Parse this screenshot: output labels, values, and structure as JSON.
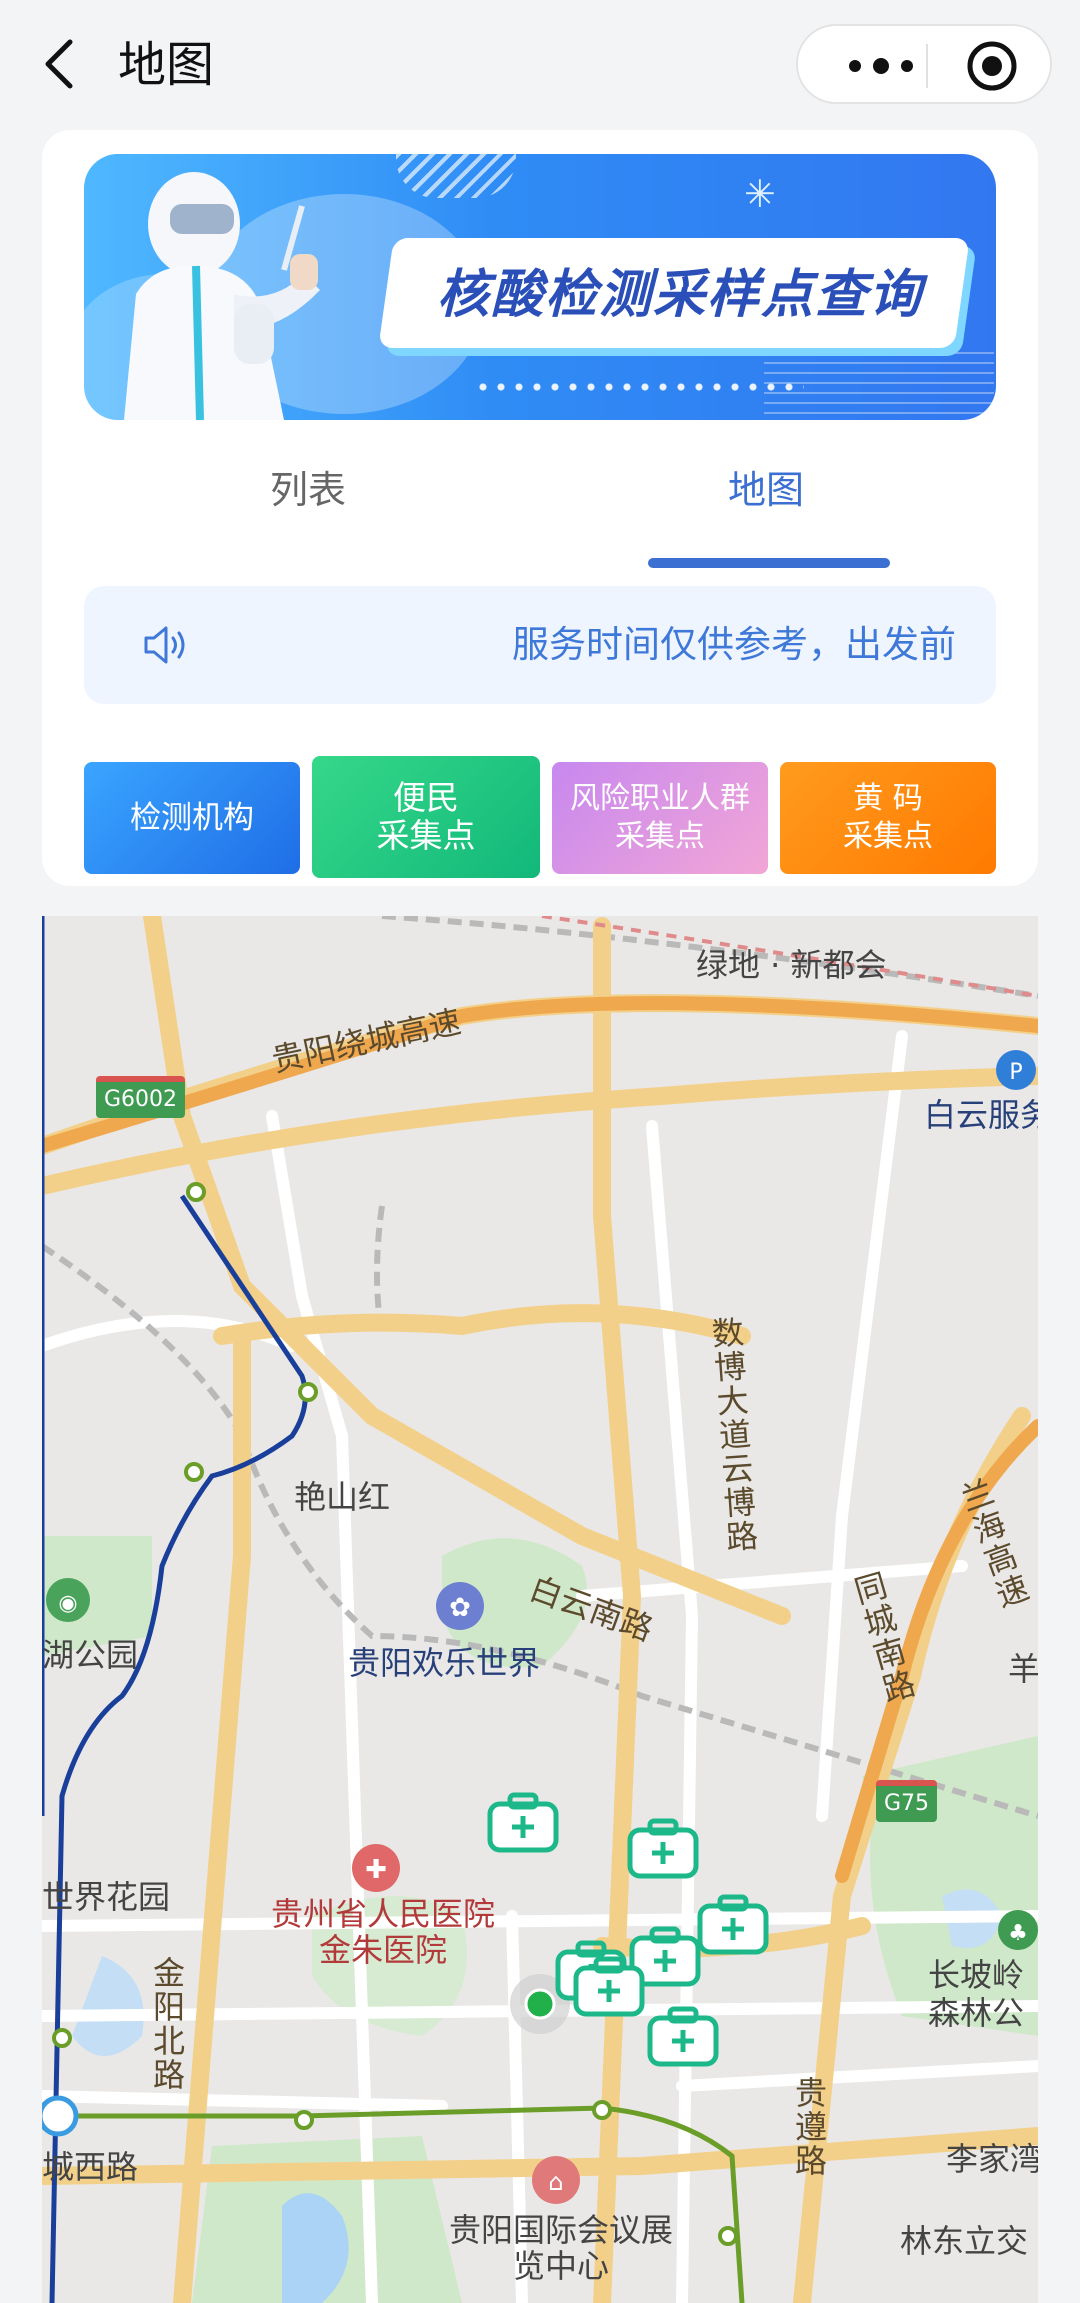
{
  "header": {
    "title": "地图"
  },
  "banner": {
    "title": "核酸检测采样点查询"
  },
  "tabs": [
    {
      "label": "列表"
    },
    {
      "label": "地图"
    }
  ],
  "notice": {
    "text": "服务时间仅供参考，出发前"
  },
  "categories": [
    {
      "label": "检测机构"
    },
    {
      "label": "便民\n采集点"
    },
    {
      "label": "风险职业人群\n采集点"
    },
    {
      "label": "黄 码\n采集点"
    }
  ],
  "map": {
    "labels": {
      "lvdi": "绿地 · 新都会",
      "raocheng": "贵阳绕城高速",
      "baiyun_service": "白云服务",
      "shubo": "数博大道云博路",
      "yanshanhong": "艳山红",
      "baiyun_south": "白云南路",
      "huanle": "贵阳欢乐世界",
      "hu_park": "湖公园",
      "tongcheng": "同城南路",
      "haigao": "兰海高速",
      "yang": "羊",
      "world_garden": "世界花园",
      "hospital": "贵州省人民医院金朱医院",
      "jinyang": "金阳北路",
      "changpo": "长坡岭森林公",
      "guizun": "贵遵路",
      "lijia": "李家湾",
      "chengxi": "城西路",
      "expo": "贵阳国际会议展览中心",
      "lindong": "林东立交"
    },
    "shields": {
      "g6002": "G6002",
      "g75": "G75"
    }
  }
}
